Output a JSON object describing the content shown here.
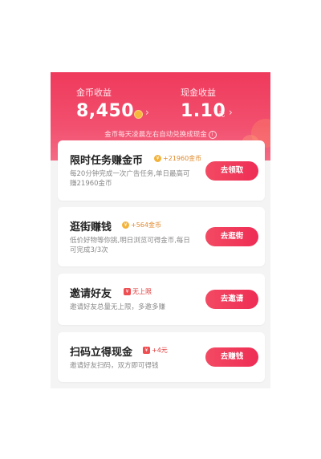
{
  "header": {
    "coin_label": "金币收益",
    "coin_value": "8,450",
    "cash_label": "现金收益",
    "cash_value": "1.10",
    "cash_unit": "元",
    "notice": "金币每天凌晨左右自动兑换成现金",
    "chevron": "›",
    "info_glyph": "i"
  },
  "tasks": [
    {
      "title": "限时任务赚金币",
      "reward": "+21960金币",
      "reward_icon": "¥",
      "desc": "每20分钟完成一次广告任务,单日最高可赚21960金币",
      "button": "去领取"
    },
    {
      "title": "逛街赚钱",
      "reward": "+564金币",
      "reward_icon": "¥",
      "desc": "低价好物等你挑,明日浏览可得金币,每日可完成3/3次",
      "button": "去逛街"
    },
    {
      "title": "邀请好友",
      "reward": "无上限",
      "reward_icon": "¥",
      "desc": "邀请好友总量无上限，多邀多赚",
      "button": "去邀请"
    },
    {
      "title": "扫码立得现金",
      "reward": "+4元",
      "reward_icon": "¥",
      "desc": "邀请好友扫码，双方即可得钱",
      "button": "去赚钱"
    }
  ],
  "colors": {
    "accent": "#ef3a5c",
    "button": "#f0385a",
    "coin": "#f3b33b"
  }
}
